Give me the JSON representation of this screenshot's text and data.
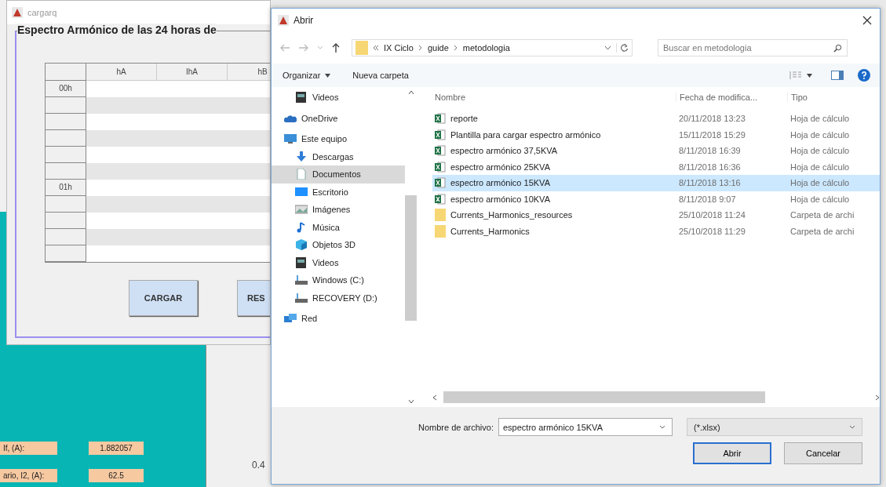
{
  "background_app": {
    "fields": [
      {
        "label": "If, (A):",
        "value": "1.882057"
      },
      {
        "label": "ario, I2, (A):",
        "value": "62.5"
      }
    ],
    "axis_tick": "0.4"
  },
  "cargarq_window": {
    "title": "cargarq",
    "panel_title": "Espectro Armónico de las 24 horas de",
    "table": {
      "columns": [
        "hA",
        "IhA",
        "hB"
      ],
      "rows": [
        {
          "hour": "00h"
        },
        {},
        {},
        {},
        {},
        {},
        {
          "hour": "01h"
        },
        {},
        {},
        {},
        {}
      ]
    },
    "buttons": [
      "CARGAR",
      "RES"
    ]
  },
  "open_dialog": {
    "title": "Abrir",
    "breadcrumb": [
      "IX Ciclo",
      "guide",
      "metodologia"
    ],
    "search": {
      "placeholder": "Buscar en metodologia"
    },
    "toolbar": [
      "Organizar",
      "Nueva carpeta"
    ],
    "nav_items": [
      {
        "label": "Videos",
        "kind": "video",
        "selected": false
      },
      {
        "label": "OneDrive",
        "kind": "cloud",
        "selected": false
      },
      {
        "label": "Este equipo",
        "kind": "computer",
        "selected": false,
        "children": [
          {
            "label": "Descargas",
            "kind": "download",
            "selected": false
          },
          {
            "label": "Documentos",
            "kind": "document",
            "selected": true
          },
          {
            "label": "Escritorio",
            "kind": "desktop",
            "selected": false
          },
          {
            "label": "Imágenes",
            "kind": "image",
            "selected": false
          },
          {
            "label": "Música",
            "kind": "music",
            "selected": false
          },
          {
            "label": "Objetos 3D",
            "kind": "cube",
            "selected": false
          },
          {
            "label": "Videos",
            "kind": "video",
            "selected": false
          },
          {
            "label": "Windows (C:)",
            "kind": "drive",
            "selected": false
          },
          {
            "label": "RECOVERY (D:)",
            "kind": "drive",
            "selected": false
          }
        ]
      },
      {
        "label": "Red",
        "kind": "network",
        "selected": false
      }
    ],
    "columns": [
      "Nombre",
      "Fecha de modifica...",
      "Tipo"
    ],
    "files": [
      {
        "name": "reporte",
        "date": "20/11/2018 13:23",
        "type": "Hoja de cálculo",
        "kind": "spreadsheet",
        "selected": false
      },
      {
        "name": "Plantilla para cargar espectro armónico",
        "date": "15/11/2018 15:29",
        "type": "Hoja de cálculo",
        "kind": "spreadsheet",
        "selected": false
      },
      {
        "name": "espectro armónico 37,5KVA",
        "date": "8/11/2018 16:39",
        "type": "Hoja de cálculo",
        "kind": "spreadsheet",
        "selected": false
      },
      {
        "name": "espectro armónico 25KVA",
        "date": "8/11/2018 16:36",
        "type": "Hoja de cálculo",
        "kind": "spreadsheet",
        "selected": false
      },
      {
        "name": "espectro armónico 15KVA",
        "date": "8/11/2018 13:16",
        "type": "Hoja de cálculo",
        "kind": "spreadsheet",
        "selected": true
      },
      {
        "name": "espectro armónico 10KVA",
        "date": "8/11/2018 9:07",
        "type": "Hoja de cálculo",
        "kind": "spreadsheet",
        "selected": false
      },
      {
        "name": "Currents_Harmonics_resources",
        "date": "25/10/2018 11:24",
        "type": "Carpeta de archi",
        "kind": "folder",
        "selected": false
      },
      {
        "name": "Currents_Harmonics",
        "date": "25/10/2018 11:29",
        "type": "Carpeta de archi",
        "kind": "folder",
        "selected": false
      }
    ],
    "filename_label": "Nombre de archivo:",
    "filename_value": "espectro armónico 15KVA",
    "filter": "(*.xlsx)",
    "buttons": [
      "Abrir",
      "Cancelar"
    ]
  }
}
